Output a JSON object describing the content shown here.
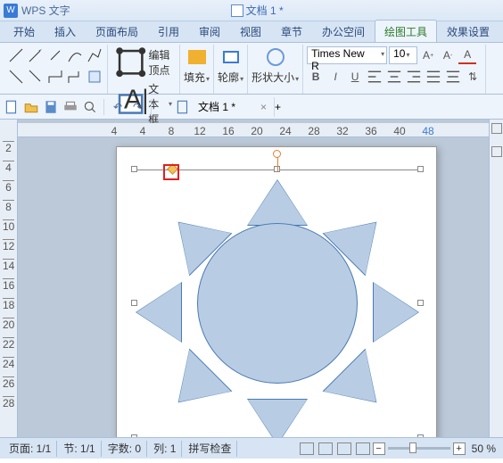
{
  "app": {
    "name": "WPS 文字",
    "doc_title": "文档 1 *"
  },
  "tabs": {
    "items": [
      "开始",
      "插入",
      "页面布局",
      "引用",
      "审阅",
      "视图",
      "章节",
      "办公空间",
      "绘图工具",
      "效果设置"
    ],
    "active_index": 8
  },
  "ribbon": {
    "edit_vertex": "编辑顶点",
    "textbox": "文本框",
    "fill": "填充",
    "outline": "轮廓",
    "shape_size": "形状大小",
    "font_name": "Times New R",
    "font_size": "10"
  },
  "doc_tab": {
    "label": "文档 1 *"
  },
  "ruler": {
    "h_ticks": [
      "4",
      "4",
      "8",
      "12",
      "16",
      "20",
      "24",
      "28",
      "32",
      "36",
      "40",
      "48"
    ]
  },
  "vruler": {
    "ticks": [
      "2",
      "4",
      "6",
      "8",
      "10",
      "12",
      "14",
      "16",
      "18",
      "20",
      "22",
      "24",
      "26",
      "28"
    ]
  },
  "status": {
    "page": "页面: 1/1",
    "section": "节: 1/1",
    "wordcount": "字数: 0",
    "col": "列: 1",
    "spellcheck": "拼写检查",
    "zoom": "50 %"
  }
}
